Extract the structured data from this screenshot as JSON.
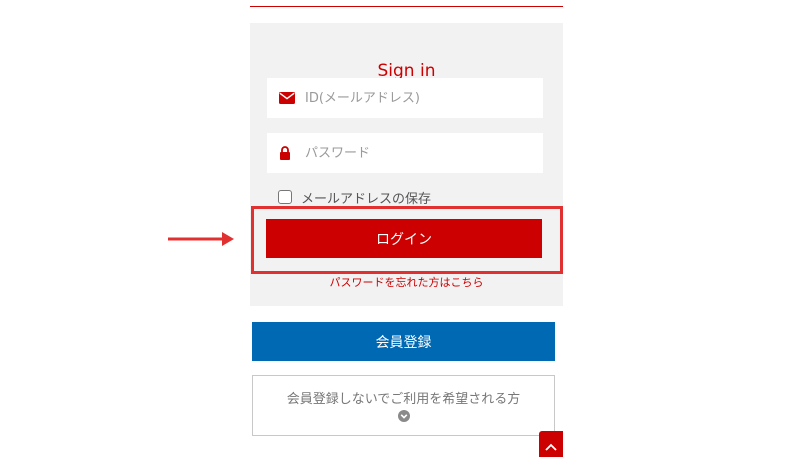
{
  "signin": {
    "title": "Sign in",
    "email_placeholder": "ID(メールアドレス)",
    "password_placeholder": "パスワード",
    "remember_label": "メールアドレスの保存",
    "remember_checked": false,
    "login_label": "ログイン",
    "forgot_label": "パスワードを忘れた方はこちら"
  },
  "register": {
    "button_label": "会員登録"
  },
  "guest": {
    "label": "会員登録しないでご利用を希望される方"
  },
  "icons": {
    "email": "envelope-icon",
    "password": "lock-icon",
    "guest_toggle": "chevron-down-circle-icon",
    "back_to_top": "chevron-up-icon",
    "pointer": "arrow-right-icon"
  },
  "colors": {
    "accent_red": "#cc0000",
    "register_blue": "#0069b4",
    "panel_bg": "#f2f2f2",
    "highlight_red": "#e03030"
  }
}
